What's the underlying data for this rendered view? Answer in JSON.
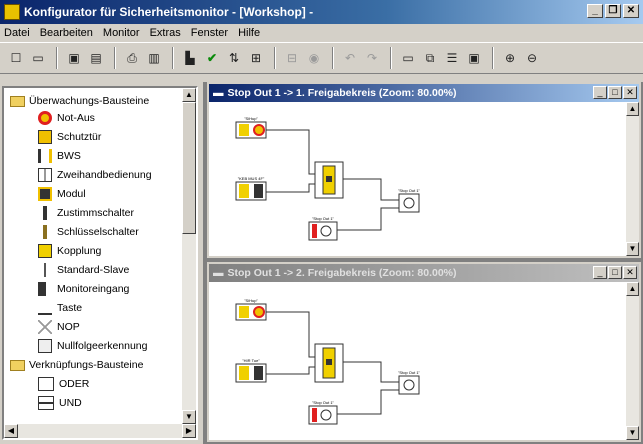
{
  "window": {
    "title": "Konfigurator für Sicherheitsmonitor - [Workshop] -",
    "minimize": "_",
    "restore": "❐",
    "close": "✕"
  },
  "menu": [
    "Datei",
    "Bearbeiten",
    "Monitor",
    "Extras",
    "Fenster",
    "Hilfe"
  ],
  "toolbar": {
    "icons": [
      "new-icon",
      "open-icon",
      "save-icon",
      "save-all-icon",
      "print-icon",
      "print-preview-icon",
      "component-icon",
      "check-icon",
      "transfer-icon",
      "grid-icon",
      "disabled-icon-1",
      "disabled-icon-2",
      "undo-icon",
      "redo-icon",
      "window-icon",
      "tile-icon",
      "cascade-icon",
      "arrange-icon",
      "zoom-in-icon",
      "zoom-out-icon"
    ]
  },
  "sidebar": {
    "group1": "Überwachungs-Bausteine",
    "items": [
      "Not-Aus",
      "Schutztür",
      "BWS",
      "Zweihandbedienung",
      "Modul",
      "Zustimmschalter",
      "Schlüsselschalter",
      "Kopplung",
      "Standard-Slave",
      "Monitoreingang",
      "Taste",
      "NOP",
      "Nullfolgeerkennung"
    ],
    "group2": "Verknüpfungs-Bausteine",
    "items2": [
      "ODER",
      "UND"
    ]
  },
  "windows": [
    {
      "title": "Stop Out 1 -> 1. Freigabekreis (Zoom: 80.00%)",
      "blocks": [
        {
          "label": "\"SiHup\""
        },
        {
          "label": "\"KEB MUS 4F\""
        },
        {
          "label": "\"Stop Out 1\""
        },
        {
          "label": "\"Stop Out 1\""
        }
      ]
    },
    {
      "title": "Stop Out 1 -> 2. Freigabekreis (Zoom: 80.00%)",
      "blocks": [
        {
          "label": "\"SiHup\""
        },
        {
          "label": "\"HIR Tue\""
        },
        {
          "label": "\"Stop Out 1\""
        },
        {
          "label": "\"Stop Out 1\""
        }
      ]
    }
  ],
  "colors": {
    "accent": "#0a246a",
    "block_yellow": "#f0d000",
    "alert_red": "#e02020"
  }
}
